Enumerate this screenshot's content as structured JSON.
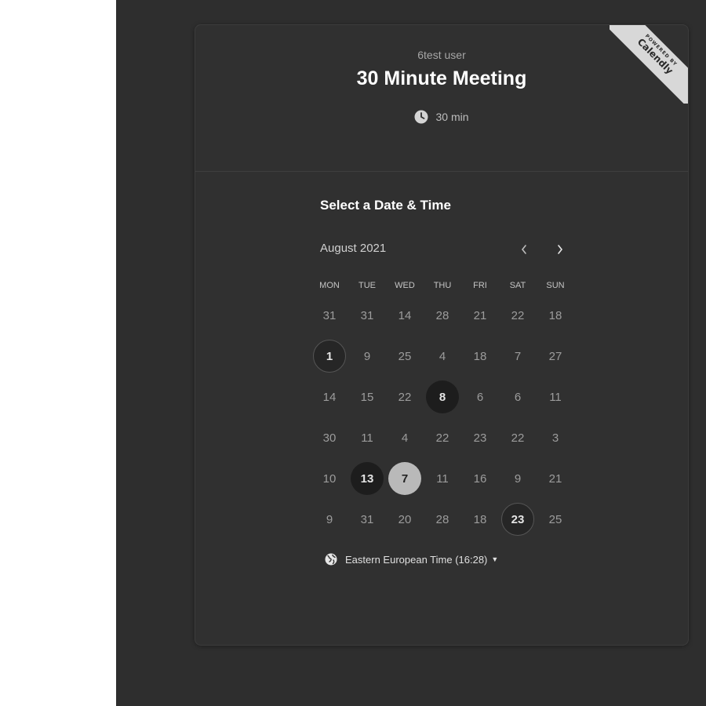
{
  "event": {
    "host": "6test user",
    "title": "30 Minute Meeting",
    "duration": "30 min"
  },
  "branding": {
    "powered_by": "POWERED BY",
    "brand": "Calendly"
  },
  "picker": {
    "heading": "Select a Date & Time",
    "month": "August 2021",
    "prev_icon": "chevron-left-icon",
    "next_icon": "chevron-right-icon",
    "weekdays": [
      "MON",
      "TUE",
      "WED",
      "THU",
      "FRI",
      "SAT",
      "SUN"
    ],
    "weeks": [
      [
        "31",
        "31",
        "14",
        "28",
        "21",
        "22",
        "18"
      ],
      [
        "1",
        "9",
        "25",
        "4",
        "18",
        "7",
        "27"
      ],
      [
        "14",
        "15",
        "22",
        "8",
        "6",
        "6",
        "11"
      ],
      [
        "30",
        "11",
        "4",
        "22",
        "23",
        "22",
        "3"
      ],
      [
        "10",
        "13",
        "7",
        "11",
        "16",
        "9",
        "21"
      ],
      [
        "9",
        "31",
        "20",
        "28",
        "18",
        "23",
        "25"
      ]
    ],
    "available_days": [
      "1",
      "8",
      "13",
      "23"
    ],
    "selected_day": "7"
  },
  "timezone": {
    "icon": "globe-icon",
    "label": "Eastern European Time (16:28)"
  },
  "colors": {
    "background": "#2e2e2e",
    "card": "#303030",
    "selected": "#b9b9b9"
  }
}
